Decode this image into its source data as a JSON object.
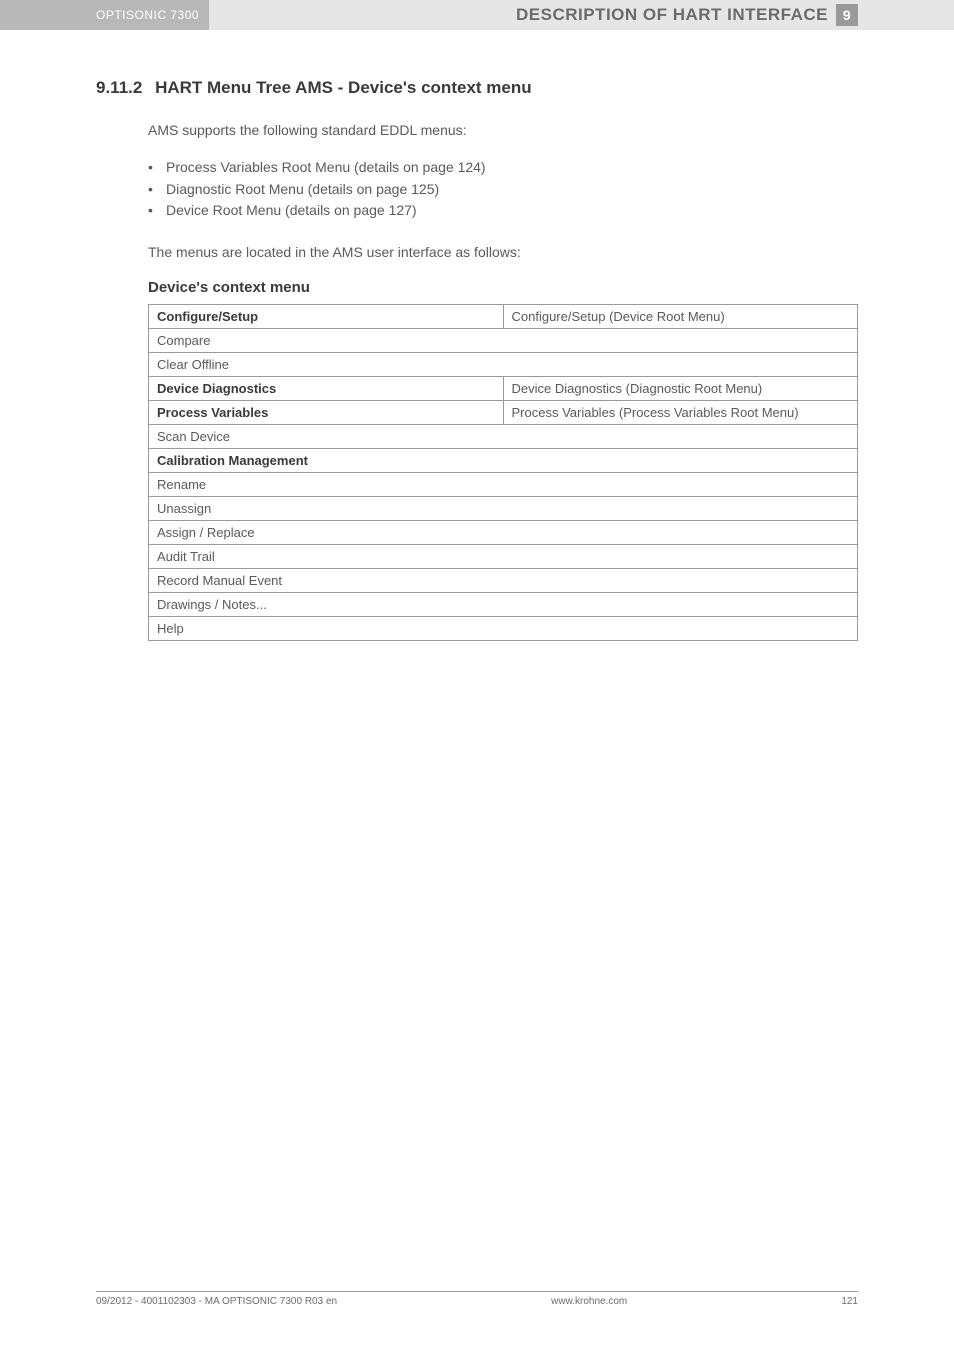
{
  "header": {
    "product": "OPTISONIC 7300",
    "title": "DESCRIPTION OF HART INTERFACE",
    "chapter": "9"
  },
  "section": {
    "number": "9.11.2",
    "title": "HART Menu Tree AMS - Device's context menu",
    "intro": "AMS supports the following standard EDDL menus:",
    "bullets": [
      "Process Variables Root Menu (details on page 124)",
      "Diagnostic Root Menu (details on page 125)",
      "Device Root Menu (details on page 127)"
    ],
    "followup": "The menus are located in the AMS user interface as follows:",
    "table_heading": "Device's context menu"
  },
  "table": [
    {
      "left": "Configure/Setup",
      "right": "Configure/Setup (Device Root Menu)",
      "bold": true,
      "span": false
    },
    {
      "left": "Compare",
      "bold": false,
      "span": true
    },
    {
      "left": "Clear Offline",
      "bold": false,
      "span": true
    },
    {
      "left": "Device Diagnostics",
      "right": "Device Diagnostics (Diagnostic Root Menu)",
      "bold": true,
      "span": false
    },
    {
      "left": "Process Variables",
      "right": "Process Variables (Process Variables Root Menu)",
      "bold": true,
      "span": false
    },
    {
      "left": "Scan Device",
      "bold": false,
      "span": true
    },
    {
      "left": "Calibration Management",
      "bold": true,
      "span": true
    },
    {
      "left": "Rename",
      "bold": false,
      "span": true
    },
    {
      "left": "Unassign",
      "bold": false,
      "span": true
    },
    {
      "left": "Assign / Replace",
      "bold": false,
      "span": true
    },
    {
      "left": "Audit Trail",
      "bold": false,
      "span": true
    },
    {
      "left": "Record Manual Event",
      "bold": false,
      "span": true
    },
    {
      "left": "Drawings / Notes...",
      "bold": false,
      "span": true
    },
    {
      "left": "Help",
      "bold": false,
      "span": true
    }
  ],
  "footer": {
    "left": "09/2012 - 4001102303 - MA OPTISONIC 7300 R03 en",
    "center": "www.krohne.com",
    "right": "121"
  }
}
